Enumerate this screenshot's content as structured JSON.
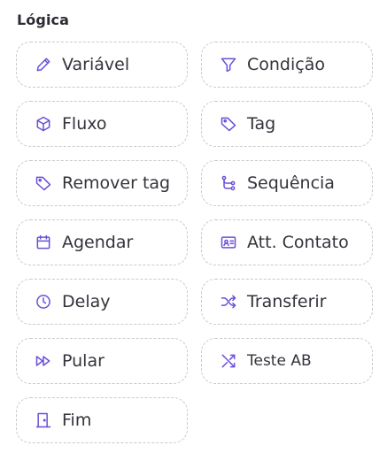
{
  "section": {
    "title": "Lógica"
  },
  "accent_color": "#6b4fd8",
  "items": [
    {
      "label": "Variável",
      "icon": "pencil-icon"
    },
    {
      "label": "Condição",
      "icon": "filter-icon"
    },
    {
      "label": "Fluxo",
      "icon": "box-icon"
    },
    {
      "label": "Tag",
      "icon": "tag-icon"
    },
    {
      "label": "Remover tag",
      "icon": "tag-remove-icon"
    },
    {
      "label": "Sequência",
      "icon": "sequence-icon"
    },
    {
      "label": "Agendar",
      "icon": "calendar-icon"
    },
    {
      "label": "Att. Contato",
      "icon": "contact-card-icon"
    },
    {
      "label": "Delay",
      "icon": "clock-icon"
    },
    {
      "label": "Transferir",
      "icon": "shuffle-icon"
    },
    {
      "label": "Pular",
      "icon": "fast-forward-icon"
    },
    {
      "label": "Teste AB",
      "icon": "ab-test-icon"
    },
    {
      "label": "Fim",
      "icon": "door-exit-icon"
    }
  ]
}
